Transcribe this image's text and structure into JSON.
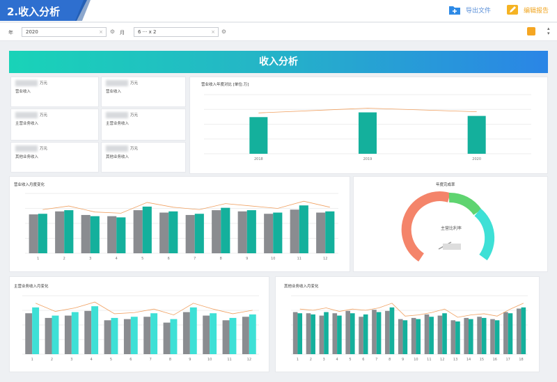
{
  "header": {
    "title": "2.收入分析",
    "export_label": "导出文件",
    "edit_label": "编辑报告"
  },
  "filters": {
    "year_label": "年",
    "year_value": "2020",
    "month_label": "月",
    "month_value": "6 ··· x 2"
  },
  "banner": {
    "title": "收入分析"
  },
  "cards": [
    {
      "unit": "万元",
      "label": "营业收入"
    },
    {
      "unit": "万元",
      "label": "营业收入"
    },
    {
      "unit": "万元",
      "label": "主营业务收入"
    },
    {
      "unit": "万元",
      "label": "主营业务收入"
    },
    {
      "unit": "万元",
      "label": "其他业务收入"
    },
    {
      "unit": "万元",
      "label": "其他业务收入"
    }
  ],
  "trend": {
    "title": "营业收入年度对比 [单位:万]"
  },
  "monthly": {
    "title": "营业收入月度变化"
  },
  "gauge": {
    "title": "年度完成率",
    "center_label": "主营比利率"
  },
  "bottom_left": {
    "title": "主营业务收入月变化"
  },
  "bottom_right": {
    "title": "其他业务收入月变化"
  },
  "colors": {
    "teal": "#14b09c",
    "gray": "#8a8c90",
    "cyan": "#3ee0d6",
    "orange": "#f0a060",
    "blue": "#2e6fcf"
  },
  "chart_data": [
    {
      "type": "bar",
      "categories": [
        "2018",
        "2019",
        "2020"
      ],
      "series": [
        {
          "values": [
            62,
            70,
            64
          ]
        }
      ],
      "ylim": [
        0,
        100
      ]
    },
    {
      "type": "bar",
      "categories": [
        "1",
        "2",
        "3",
        "4",
        "5",
        "6",
        "7",
        "8",
        "9",
        "10",
        "11",
        "12"
      ],
      "series": [
        {
          "values": [
            65,
            70,
            64,
            62,
            72,
            68,
            64,
            72,
            70,
            66,
            73,
            68
          ]
        },
        {
          "values": [
            66,
            72,
            62,
            60,
            78,
            70,
            66,
            76,
            72,
            68,
            80,
            70
          ]
        }
      ],
      "ylim": [
        0,
        100
      ]
    },
    {
      "type": "bar",
      "categories": [
        "1",
        "2",
        "3",
        "4",
        "5",
        "6",
        "7",
        "8",
        "9",
        "10",
        "11",
        "12"
      ],
      "series": [
        {
          "values": [
            70,
            62,
            66,
            74,
            58,
            60,
            64,
            54,
            72,
            66,
            58,
            64
          ]
        },
        {
          "values": [
            80,
            66,
            72,
            82,
            62,
            64,
            70,
            60,
            80,
            70,
            62,
            68
          ]
        }
      ],
      "ylim": [
        0,
        100
      ]
    },
    {
      "type": "bar",
      "categories": [
        "1",
        "2",
        "3",
        "4",
        "5",
        "6",
        "7",
        "8",
        "9",
        "10",
        "11",
        "12",
        "13",
        "14",
        "15",
        "16",
        "17",
        "18"
      ],
      "series": [
        {
          "values": [
            72,
            70,
            66,
            70,
            74,
            64,
            76,
            74,
            60,
            62,
            68,
            66,
            58,
            62,
            64,
            60,
            72,
            78
          ]
        },
        {
          "values": [
            70,
            68,
            72,
            66,
            70,
            68,
            72,
            80,
            58,
            60,
            64,
            70,
            56,
            60,
            62,
            58,
            70,
            80
          ]
        }
      ],
      "ylim": [
        0,
        100
      ]
    }
  ]
}
